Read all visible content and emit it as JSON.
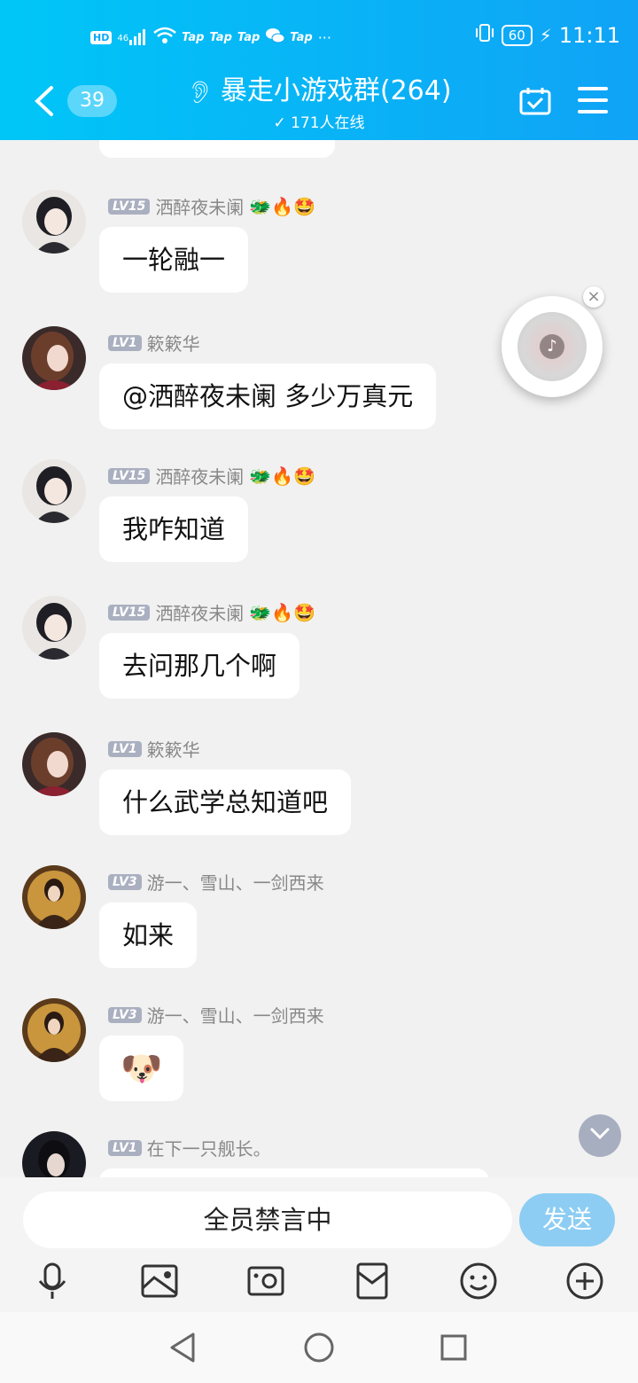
{
  "status_bar": {
    "hd": "HD",
    "signal": "46",
    "apps": [
      "Tap",
      "Tap",
      "Tap",
      "Tap"
    ],
    "more": "···",
    "battery": "60",
    "time": "11:11"
  },
  "header": {
    "unread_count": "39",
    "title": "暴走小游戏群(264)",
    "online": "171人在线"
  },
  "messages": [
    {
      "level": "LV15",
      "name": "洒醉夜未阑",
      "emoji": "🐲🔥🤩",
      "text": "一轮融一"
    },
    {
      "level": "LV1",
      "name": "簌簌华",
      "emoji": "",
      "text": "@洒醉夜未阑 多少万真元"
    },
    {
      "level": "LV15",
      "name": "洒醉夜未阑",
      "emoji": "🐲🔥🤩",
      "text": "我咋知道"
    },
    {
      "level": "LV15",
      "name": "洒醉夜未阑",
      "emoji": "🐲🔥🤩",
      "text": "去问那几个啊"
    },
    {
      "level": "LV1",
      "name": "簌簌华",
      "emoji": "",
      "text": "什么武学总知道吧"
    },
    {
      "level": "LV3",
      "name": "游一、雪山、一剑西来",
      "emoji": "",
      "text": "如来"
    },
    {
      "level": "LV3",
      "name": "游一、雪山、一剑西来",
      "emoji": "",
      "text": "🐶"
    },
    {
      "level": "LV1",
      "name": "在下一只舰长。",
      "emoji": "",
      "text": ""
    }
  ],
  "music_player": {
    "close": "×",
    "note": "♪"
  },
  "input_bar": {
    "placeholder": "全员禁言中",
    "send": "发送"
  },
  "colors": {
    "accent": "#10a3f6",
    "send_button": "#8dcdf3"
  }
}
